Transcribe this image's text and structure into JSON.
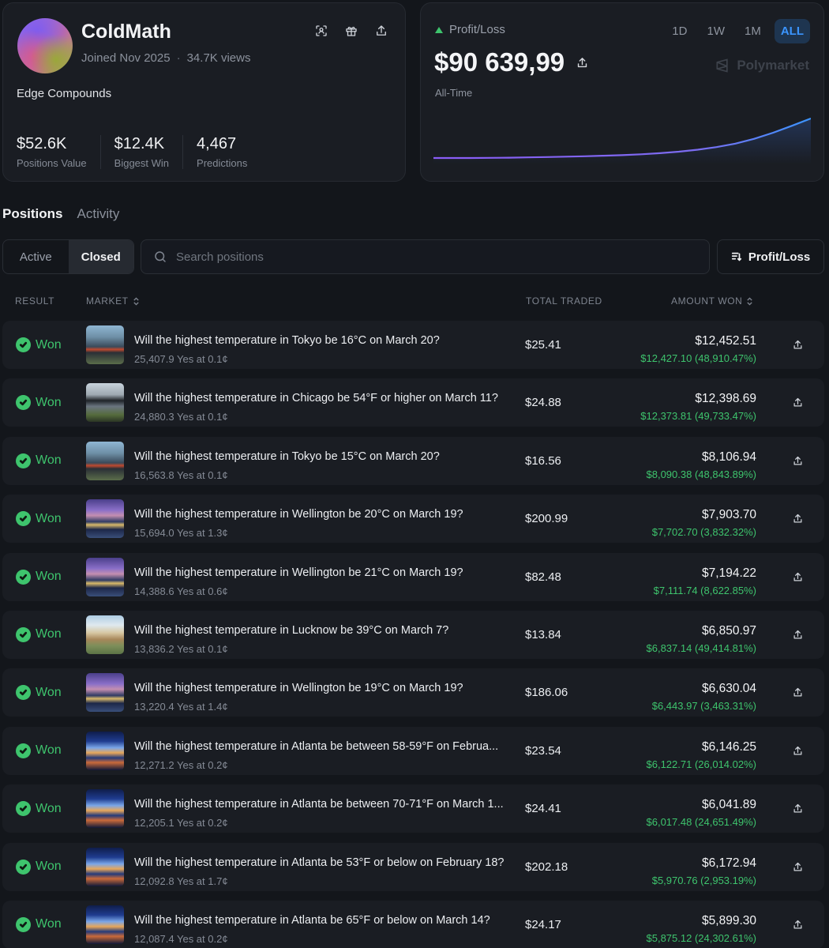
{
  "profile": {
    "name": "ColdMath",
    "joined": "Joined Nov 2025",
    "views": "34.7K views",
    "bio": "Edge Compounds",
    "stats": [
      {
        "value": "$52.6K",
        "label": "Positions Value"
      },
      {
        "value": "$12.4K",
        "label": "Biggest Win"
      },
      {
        "value": "4,467",
        "label": "Predictions"
      }
    ],
    "icons": [
      "scan-icon",
      "gift-icon",
      "share-icon"
    ]
  },
  "pnl": {
    "label": "Profit/Loss",
    "value": "$90 639,99",
    "period": "All-Time",
    "brand": "Polymarket",
    "ranges": [
      "1D",
      "1W",
      "1M",
      "ALL"
    ],
    "active_range": "ALL",
    "colors": {
      "line_start": "#8b5cf6",
      "line_end": "#3b95ff",
      "up": "#3ec46d"
    }
  },
  "chart_data": {
    "type": "area",
    "x": [
      0,
      5,
      10,
      15,
      20,
      25,
      30,
      35,
      40,
      45,
      50,
      55,
      60,
      65,
      70,
      75,
      80,
      85,
      90,
      95,
      100
    ],
    "values": [
      0,
      0,
      0,
      300,
      800,
      1500,
      2200,
      3000,
      4000,
      5200,
      6500,
      8500,
      11000,
      14500,
      19000,
      25000,
      33000,
      44000,
      58000,
      74000,
      90639.99
    ],
    "title": "",
    "xlabel": "",
    "ylabel": "",
    "grid": false
  },
  "tabs": {
    "main": [
      "Positions",
      "Activity"
    ],
    "active_main": "Positions",
    "status": [
      "Active",
      "Closed"
    ],
    "active_status": "Closed"
  },
  "search": {
    "placeholder": "Search positions",
    "value": ""
  },
  "sort": {
    "label": "Profit/Loss"
  },
  "columns": {
    "result": "RESULT",
    "market": "MARKET",
    "total_traded": "TOTAL TRADED",
    "amount_won": "AMOUNT WON"
  },
  "positions": [
    {
      "result": "Won",
      "thumb": "tokyo",
      "question": "Will the highest temperature in Tokyo be 16°C on March 20?",
      "sub": "25,407.9 Yes at 0.1¢",
      "traded": "$25.41",
      "won": "$12,452.51",
      "gain": "$12,427.10 (48,910.47%)"
    },
    {
      "result": "Won",
      "thumb": "chicago",
      "question": "Will the highest temperature in Chicago be 54°F or higher on March 11?",
      "sub": "24,880.3 Yes at 0.1¢",
      "traded": "$24.88",
      "won": "$12,398.69",
      "gain": "$12,373.81 (49,733.47%)"
    },
    {
      "result": "Won",
      "thumb": "tokyo",
      "question": "Will the highest temperature in Tokyo be 15°C on March 20?",
      "sub": "16,563.8 Yes at 0.1¢",
      "traded": "$16.56",
      "won": "$8,106.94",
      "gain": "$8,090.38 (48,843.89%)"
    },
    {
      "result": "Won",
      "thumb": "wellington",
      "question": "Will the highest temperature in Wellington be 20°C on March 19?",
      "sub": "15,694.0 Yes at 1.3¢",
      "traded": "$200.99",
      "won": "$7,903.70",
      "gain": "$7,702.70 (3,832.32%)"
    },
    {
      "result": "Won",
      "thumb": "wellington",
      "question": "Will the highest temperature in Wellington be 21°C on March 19?",
      "sub": "14,388.6 Yes at 0.6¢",
      "traded": "$82.48",
      "won": "$7,194.22",
      "gain": "$7,111.74 (8,622.85%)"
    },
    {
      "result": "Won",
      "thumb": "lucknow",
      "question": "Will the highest temperature in Lucknow be 39°C on March 7?",
      "sub": "13,836.2 Yes at 0.1¢",
      "traded": "$13.84",
      "won": "$6,850.97",
      "gain": "$6,837.14 (49,414.81%)"
    },
    {
      "result": "Won",
      "thumb": "wellington",
      "question": "Will the highest temperature in Wellington be 19°C on March 19?",
      "sub": "13,220.4 Yes at 1.4¢",
      "traded": "$186.06",
      "won": "$6,630.04",
      "gain": "$6,443.97 (3,463.31%)"
    },
    {
      "result": "Won",
      "thumb": "atlanta",
      "question": "Will the highest temperature in Atlanta be between 58-59°F on Februa...",
      "sub": "12,271.2 Yes at 0.2¢",
      "traded": "$23.54",
      "won": "$6,146.25",
      "gain": "$6,122.71 (26,014.02%)"
    },
    {
      "result": "Won",
      "thumb": "atlanta",
      "question": "Will the highest temperature in Atlanta be between 70-71°F on March 1...",
      "sub": "12,205.1 Yes at 0.2¢",
      "traded": "$24.41",
      "won": "$6,041.89",
      "gain": "$6,017.48 (24,651.49%)"
    },
    {
      "result": "Won",
      "thumb": "atlanta",
      "question": "Will the highest temperature in Atlanta be 53°F or below on February 18?",
      "sub": "12,092.8 Yes at 1.7¢",
      "traded": "$202.18",
      "won": "$6,172.94",
      "gain": "$5,970.76 (2,953.19%)"
    },
    {
      "result": "Won",
      "thumb": "atlanta",
      "question": "Will the highest temperature in Atlanta be 65°F or below on March 14?",
      "sub": "12,087.4 Yes at 0.2¢",
      "traded": "$24.17",
      "won": "$5,899.30",
      "gain": "$5,875.12 (24,302.61%)"
    }
  ]
}
